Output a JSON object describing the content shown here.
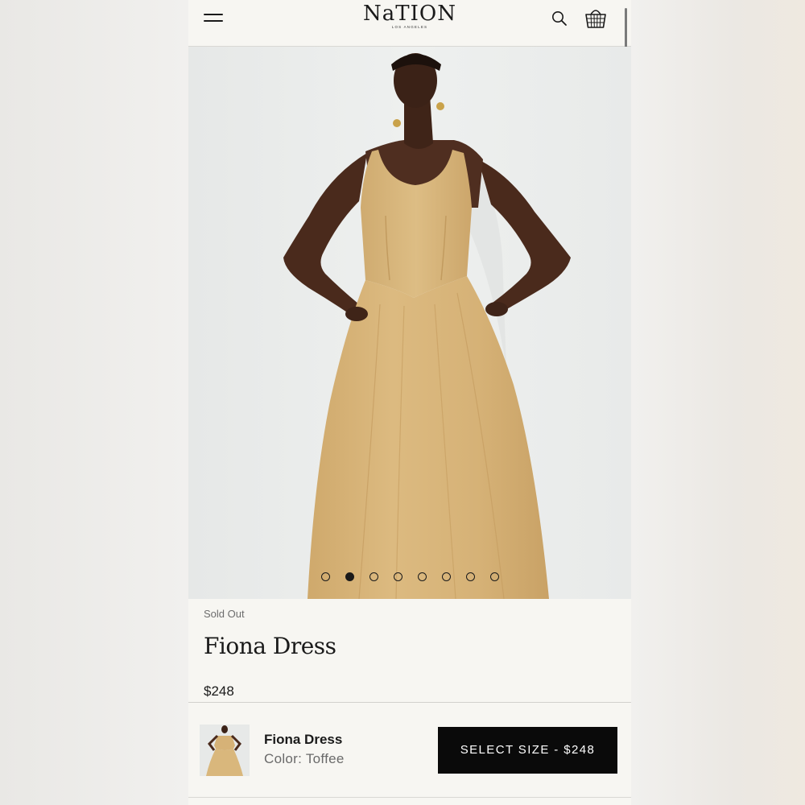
{
  "header": {
    "logo_main": "NaTION",
    "logo_sub": "LOS ANGELES",
    "icons": [
      "menu-icon",
      "search-icon",
      "basket-icon"
    ]
  },
  "gallery": {
    "image_count": 8,
    "active_index": 1
  },
  "product": {
    "status": "Sold Out",
    "title": "Fiona Dress",
    "price": "$248"
  },
  "sticky_bar": {
    "name": "Fiona Dress",
    "color_text": "Color: Toffee",
    "button_label": "SELECT SIZE - $248"
  },
  "colors": {
    "dress": "#d8b57a",
    "button_bg": "#0a0a0a",
    "page_bg": "#f7f6f2"
  }
}
